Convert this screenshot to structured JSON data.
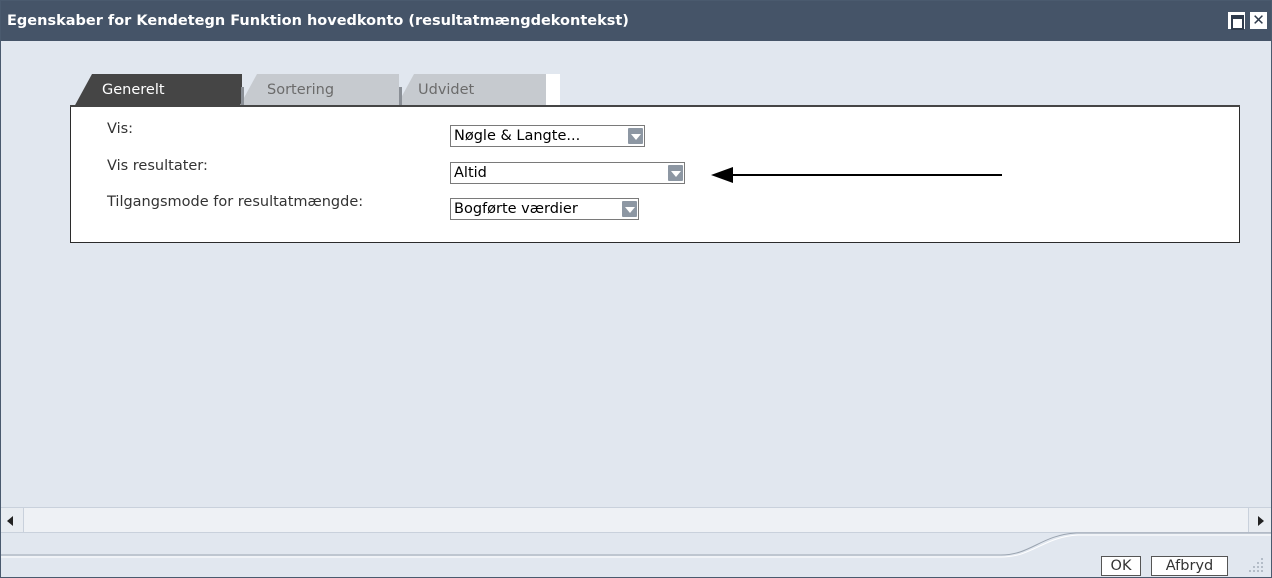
{
  "window": {
    "title": "Egenskaber for Kendetegn Funktion hovedkonto (resultatmængdekontekst)",
    "maximize_icon": "maximize-icon",
    "close_icon": "close-icon",
    "close_glyph": "✕"
  },
  "tabs": [
    {
      "label": "Generelt",
      "active": true
    },
    {
      "label": "Sortering",
      "active": false
    },
    {
      "label": "Udvidet",
      "active": false
    }
  ],
  "fields": [
    {
      "label": "Vis:",
      "value": "Nøgle & Langte..."
    },
    {
      "label": "Vis resultater:",
      "value": "Altid"
    },
    {
      "label": "Tilgangsmode for resultatmængde:",
      "value": "Bogførte værdier"
    }
  ],
  "buttons": {
    "ok": "OK",
    "cancel": "Afbryd"
  },
  "colors": {
    "titlebar": "#455468",
    "background": "#e1e7ef",
    "active_tab": "#454545",
    "inactive_tab": "#c6cacf"
  }
}
